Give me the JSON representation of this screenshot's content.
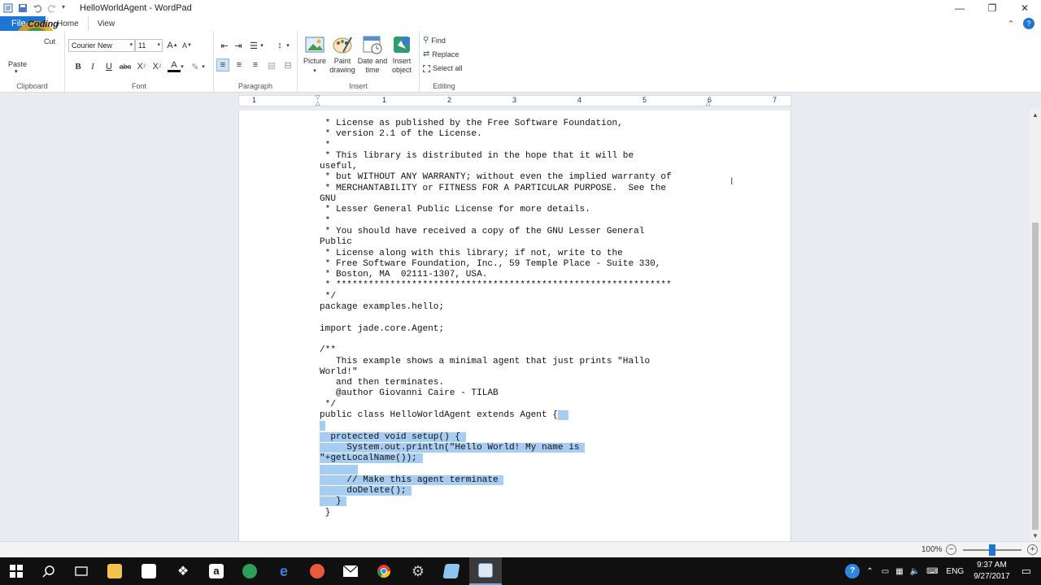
{
  "window": {
    "title": "HelloWorldAgent - WordPad",
    "controls": [
      "minimize",
      "restore",
      "close"
    ]
  },
  "tabs": {
    "file": "File",
    "home": "Home",
    "view": "View"
  },
  "overlay_logo_text": "Coding",
  "ribbon": {
    "clipboard": {
      "label": "Clipboard",
      "paste": "Paste",
      "cut": "Cut"
    },
    "font": {
      "label": "Font",
      "family": "Courier New",
      "size": "11"
    },
    "paragraph": {
      "label": "Paragraph"
    },
    "insert": {
      "label": "Insert",
      "picture": "Picture",
      "paint_drawing_1": "Paint",
      "paint_drawing_2": "drawing",
      "date_time_1": "Date and",
      "date_time_2": "time",
      "insert_object_1": "Insert",
      "insert_object_2": "object"
    },
    "editing": {
      "label": "Editing",
      "find": "Find",
      "replace": "Replace",
      "select_all": "Select all"
    }
  },
  "ruler": {
    "numbers": [
      "1",
      "1",
      "2",
      "3",
      "4",
      "5",
      "6",
      "7"
    ]
  },
  "document": {
    "lines": [
      {
        "text": " * License as published by the Free Software Foundation,",
        "sel": ""
      },
      {
        "text": " * version 2.1 of the License.",
        "sel": ""
      },
      {
        "text": " *",
        "sel": ""
      },
      {
        "text": " * This library is distributed in the hope that it will be",
        "sel": ""
      },
      {
        "text": "useful,",
        "sel": ""
      },
      {
        "text": " * but WITHOUT ANY WARRANTY; without even the implied warranty of",
        "sel": ""
      },
      {
        "text": " * MERCHANTABILITY or FITNESS FOR A PARTICULAR PURPOSE.  See the",
        "sel": ""
      },
      {
        "text": "GNU",
        "sel": ""
      },
      {
        "text": " * Lesser General Public License for more details.",
        "sel": ""
      },
      {
        "text": " *",
        "sel": ""
      },
      {
        "text": " * You should have received a copy of the GNU Lesser General",
        "sel": ""
      },
      {
        "text": "Public",
        "sel": ""
      },
      {
        "text": " * License along with this library; if not, write to the",
        "sel": ""
      },
      {
        "text": " * Free Software Foundation, Inc., 59 Temple Place - Suite 330,",
        "sel": ""
      },
      {
        "text": " * Boston, MA  02111-1307, USA.",
        "sel": ""
      },
      {
        "text": " * **************************************************************",
        "sel": ""
      },
      {
        "text": " */",
        "sel": ""
      },
      {
        "text": "package examples.hello;",
        "sel": ""
      },
      {
        "text": "",
        "sel": ""
      },
      {
        "text": "import jade.core.Agent;",
        "sel": ""
      },
      {
        "text": "",
        "sel": ""
      },
      {
        "text": "/**",
        "sel": ""
      },
      {
        "text": "   This example shows a minimal agent that just prints \"Hallo",
        "sel": ""
      },
      {
        "text": "World!\"",
        "sel": ""
      },
      {
        "text": "   and then terminates.",
        "sel": ""
      },
      {
        "text": "   @author Giovanni Caire - TILAB",
        "sel": ""
      },
      {
        "text": " */",
        "sel": ""
      },
      {
        "text": "public class HelloWorldAgent extends Agent {",
        "sel": "  "
      },
      {
        "text": "",
        "sel": " "
      },
      {
        "text": "",
        "sel": "  protected void setup() { "
      },
      {
        "text": "",
        "sel": "     System.out.println(\"Hello World! My name is "
      },
      {
        "text": "",
        "sel": "\"+getLocalName()); "
      },
      {
        "text": "",
        "sel": "       "
      },
      {
        "text": "",
        "sel": "     // Make this agent terminate "
      },
      {
        "text": "",
        "sel": "     doDelete(); "
      },
      {
        "text": "",
        "sel": "   } "
      },
      {
        "text": " }",
        "sel": ""
      }
    ]
  },
  "status": {
    "zoom": "100%",
    "zoom_fraction": 0.5
  },
  "taskbar": {
    "apps": [
      "start",
      "search",
      "task-view",
      "file-explorer",
      "store",
      "dropbox",
      "amazon",
      "tripadvisor",
      "edge",
      "app-orange",
      "mail",
      "chrome",
      "settings",
      "notepad",
      "wordpad"
    ],
    "language": "ENG",
    "time": "9:37 AM",
    "date": "9/27/2017"
  }
}
